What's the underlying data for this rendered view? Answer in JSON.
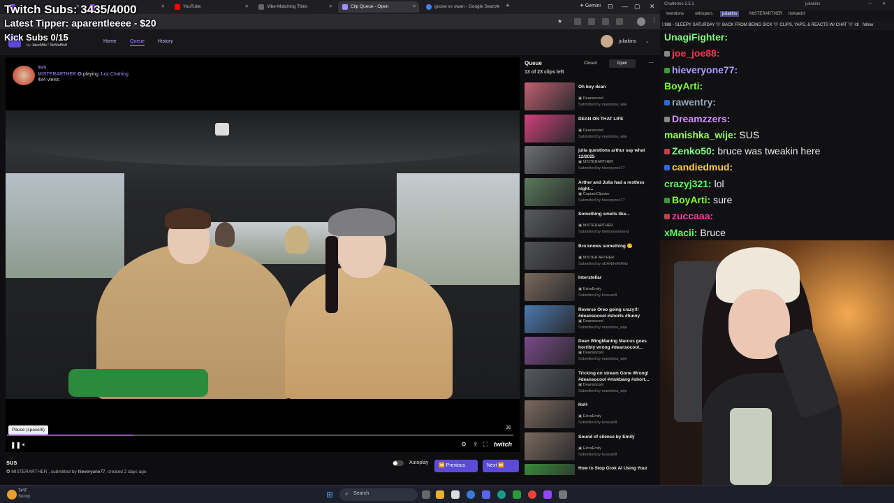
{
  "overlay": {
    "twitch_subs": "Twitch Subs: 3435/4000",
    "latest_tipper": "Latest Tipper: aparentleeee - $20",
    "kick_subs": "Kick Subs 0/15"
  },
  "browser": {
    "tabs": [
      {
        "label": "YouTube"
      },
      {
        "label": "Vibe-Matching Titles"
      },
      {
        "label": "Clip Queue - Open"
      },
      {
        "label": "goose vs swan - Google Search"
      }
    ],
    "gemini_label": "Gemini"
  },
  "site": {
    "byline": "by",
    "owner1": "JakeMiki",
    "owner2": "SirMuffin9",
    "nav": {
      "home": "Home",
      "queue": "Queue",
      "history": "History"
    },
    "username": "juliakins"
  },
  "clip": {
    "title": "sus",
    "broadcaster": "MISTERARTHER",
    "playing": "playing",
    "game": "Just Chatting",
    "views": "484 views",
    "progress_fraction": 0.25,
    "time_label": "36",
    "tooltip": "Pause (space/k)",
    "submitted_by_prefix": "MISTERARTHER , submitted by",
    "submitter": "hieveryone77",
    "created": ", created 2 days ago",
    "autoplay": "Autoplay",
    "previous": "Previous",
    "next": "Next",
    "twitch_logo": "twitch"
  },
  "queue": {
    "title": "Queue",
    "closed_label": "Closed",
    "open_label": "Open",
    "count": "13 of 23 clips left",
    "items": [
      {
        "title": "Oh boy dean",
        "channel": "Deansocool",
        "submitter": "Submitted by manishka_wije",
        "color": "#c06070"
      },
      {
        "title": "DEAN ON THAT LIFE",
        "channel": "Deansocool",
        "submitter": "Submitted by manishka_wije",
        "color": "#d0407a"
      },
      {
        "title": "julia questions arthur say what 12/2025",
        "channel": "MISTERARTHER",
        "submitter": "Submitted by hieveryone77",
        "color": "#6d6f70"
      },
      {
        "title": "Arther and Julia had a restless night...",
        "channel": "CaptainClipster",
        "submitter": "Submitted by hieveryone77",
        "color": "#5a7a5a"
      },
      {
        "title": "Something smells like...",
        "channel": "MISTERARTHER",
        "submitter": "Submitted by thelicensednerd",
        "color": "#595b5e"
      },
      {
        "title": "Bro knows something 🤨",
        "channel": "MISTER ARTHER",
        "submitter": "Submitted by oDANtheMANo",
        "color": "#505254"
      },
      {
        "title": "Interstellar",
        "channel": "ExtraEmily",
        "submitter": "Submitted by kossain8",
        "color": "#7a6a5c"
      },
      {
        "title": "Reverse Oreo going crazy!!! #deansocool #shorts #funny",
        "channel": "Deansocool",
        "submitter": "Submitted by manishka_wije",
        "color": "#4a7ab0"
      },
      {
        "title": "Dean WingManing Marcus goes horribly wrong #deansocool...",
        "channel": "Deansocool",
        "submitter": "Submitted by manishka_wije",
        "color": "#7a4a8a"
      },
      {
        "title": "Tricking on stream Gone Wrong! #deansocool #mukbang #short...",
        "channel": "Deansocool",
        "submitter": "Submitted by manishka_wije",
        "color": "#555a60"
      },
      {
        "title": "HxH",
        "channel": "ExtraEmily",
        "submitter": "Submitted by kossain8",
        "color": "#7a6a5c"
      },
      {
        "title": "Sound of silence by Emily",
        "channel": "ExtraEmily",
        "submitter": "Submitted by kossain8",
        "color": "#7a6a5c"
      },
      {
        "title": "How to Stop Grok AI Using Your",
        "channel": "",
        "submitter": "",
        "color": "#3a8a3a"
      }
    ]
  },
  "chat": {
    "app_title": "Chatterino 2.5.1",
    "user": "juliakins",
    "tabs": [
      "/mentions",
      "/whispers",
      "juliakins",
      "MISTERARTHER",
      "itsKatchii"
    ],
    "banner": "!.988 - SLEEPY SATURDAY 🖤 BACK FROM BEING SICK 🖤 CLIPS, YAPS, & REACTS W/ CHAT 🖤 !dl",
    "follow": "follow",
    "messages": [
      {
        "user": "UnagiFighter:",
        "msg": "",
        "color": "#7fff7f"
      },
      {
        "user": "joe_joe88:",
        "msg": "",
        "color": "#ff3355"
      },
      {
        "user": "hieveryone77:",
        "msg": "",
        "color": "#b09cff"
      },
      {
        "user": "BoyArti:",
        "msg": "",
        "color": "#7fff3a"
      },
      {
        "user": "rawentry:",
        "msg": "",
        "color": "#8faab8"
      },
      {
        "user": "Dreamzzers:",
        "msg": "",
        "color": "#d88cff"
      },
      {
        "user": "manishka_wije:",
        "msg": "SUS",
        "color": "#9aff5a"
      },
      {
        "user": "Zenko50:",
        "msg": "bruce was tweakin here",
        "color": "#7fff7f"
      },
      {
        "user": "candiedmud:",
        "msg": "",
        "color": "#ffcc40"
      },
      {
        "user": "crazyj321:",
        "msg": "lol",
        "color": "#5aff5a"
      },
      {
        "user": "BoyArti:",
        "msg": "sure",
        "color": "#7fff3a"
      },
      {
        "user": "zuccaaa:",
        "msg": "",
        "color": "#ff3aa0"
      },
      {
        "user": "xMacii:",
        "msg": "Bruce",
        "color": "#5aff5a"
      }
    ]
  },
  "taskbar": {
    "weather_temp": "74°F",
    "weather_desc": "Sunny",
    "search": "Search"
  }
}
